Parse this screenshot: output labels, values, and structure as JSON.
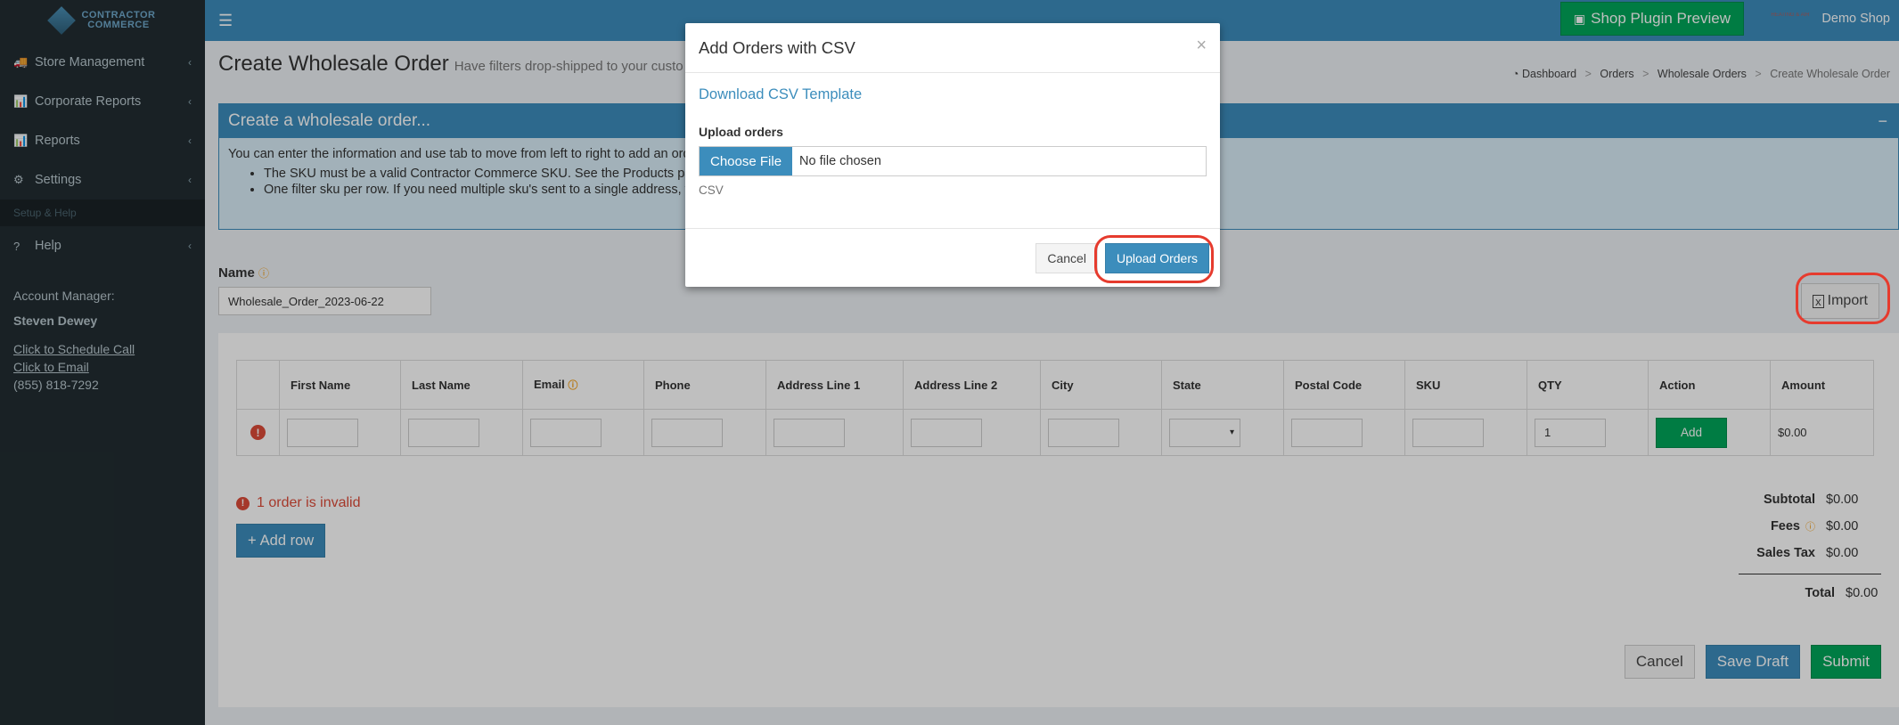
{
  "app": {
    "logo_text_1": "CONTRACTOR",
    "logo_text_2": "COMMERCE",
    "shop_plugin_preview": "Shop Plugin Preview",
    "mini_logo_text": "HEATING & AIR",
    "demo_shop": "Demo Shop"
  },
  "sidebar": {
    "items": [
      {
        "label": "Store Management",
        "icon": "truck-icon",
        "glyph": "🚚"
      },
      {
        "label": "Corporate Reports",
        "icon": "bar-chart-icon",
        "glyph": "📊"
      },
      {
        "label": "Reports",
        "icon": "bar-chart-icon",
        "glyph": "📊"
      },
      {
        "label": "Settings",
        "icon": "gear-icon",
        "glyph": "⚙"
      }
    ],
    "header": "Setup & Help",
    "help": {
      "label": "Help",
      "icon": "question-circle-icon",
      "glyph": "?"
    },
    "account_title": "Account Manager:",
    "account_name": "Steven Dewey",
    "schedule_call": "Click to Schedule Call",
    "email_link": "Click to Email",
    "phone": "(855) 818-7292"
  },
  "page": {
    "title": "Create Wholesale Order",
    "subtitle": "Have filters drop-shipped to your custo",
    "breadcrumb": [
      "Dashboard",
      "Orders",
      "Wholesale Orders",
      "Create Wholesale Order"
    ],
    "info_title": "Create a wholesale order...",
    "info_text": "You can enter the information and use tab to move from left to right to add an orde",
    "info_bullets": [
      "The SKU must be a valid Contractor Commerce SKU. See the Products pag",
      "One filter sku per row. If you need multiple sku's sent to a single address, th"
    ],
    "name_label": "Name",
    "name_value": "Wholesale_Order_2023-06-22",
    "import_label": "Import"
  },
  "table": {
    "headers": [
      "First Name",
      "Last Name",
      "Email",
      "Phone",
      "Address Line 1",
      "Address Line 2",
      "City",
      "State",
      "Postal Code",
      "SKU",
      "QTY",
      "Action",
      "Amount"
    ],
    "row": {
      "qty": "1",
      "action": "Add",
      "amount": "$0.00"
    }
  },
  "summary": {
    "invalid_text": "1 order is invalid",
    "add_row": "Add row",
    "subtotal_label": "Subtotal",
    "subtotal": "$0.00",
    "fees_label": "Fees",
    "fees": "$0.00",
    "tax_label": "Sales Tax",
    "tax": "$0.00",
    "total_label": "Total",
    "total": "$0.00"
  },
  "footer_buttons": {
    "cancel": "Cancel",
    "save_draft": "Save Draft",
    "submit": "Submit"
  },
  "modal": {
    "title": "Add Orders with CSV",
    "close": "×",
    "download_link": "Download CSV Template",
    "upload_label": "Upload orders",
    "choose_file": "Choose File",
    "no_file": "No file chosen",
    "help_text": "CSV",
    "cancel": "Cancel",
    "upload": "Upload Orders"
  },
  "colors": {
    "primary": "#3c8dbc",
    "success": "#00a65a",
    "danger": "#dd4b39",
    "sidebar": "#222d32",
    "annotation": "#e63b2e"
  }
}
